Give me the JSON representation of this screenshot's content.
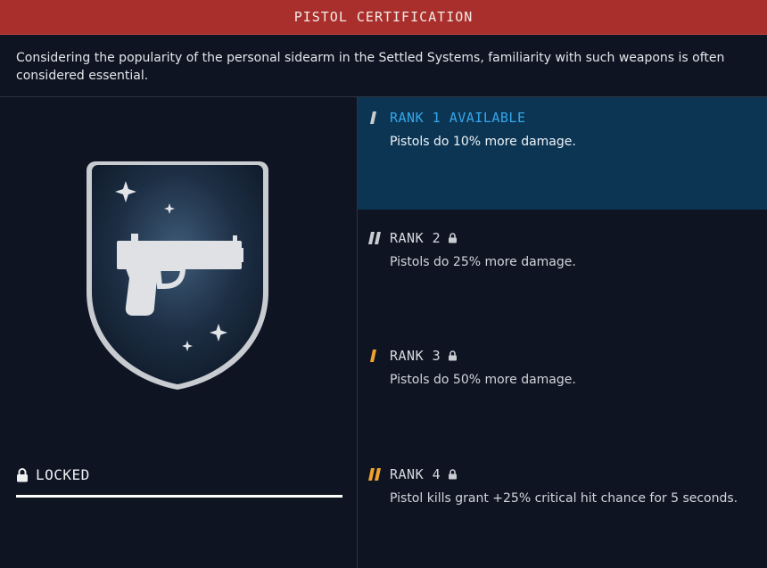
{
  "header": {
    "title": "PISTOL CERTIFICATION"
  },
  "description": "Considering the popularity of the personal sidearm in the Settled Systems, familiarity with such weapons is often considered essential.",
  "status": {
    "label": "LOCKED",
    "progress": 1.0
  },
  "badge": {
    "icon": "pistol-icon",
    "shape": "shield"
  },
  "ranks": [
    {
      "label": "RANK 1 AVAILABLE",
      "text": "Pistols do 10% more damage.",
      "locked": false,
      "active": true,
      "marker_color": "#c9ccd1"
    },
    {
      "label": "RANK 2",
      "text": "Pistols do 25% more damage.",
      "locked": true,
      "active": false,
      "marker_color": "#c9ccd1"
    },
    {
      "label": "RANK 3",
      "text": "Pistols do 50% more damage.",
      "locked": true,
      "active": false,
      "marker_color": "#f0a22c"
    },
    {
      "label": "RANK 4",
      "text": "Pistol kills grant +25% critical hit chance for 5 seconds.",
      "locked": true,
      "active": false,
      "marker_color": "#f0a22c"
    }
  ],
  "colors": {
    "header_red": "#a92f2c",
    "active_blue": "#0c3554",
    "available_text": "#34a7ea",
    "tier_gold": "#f0a22c"
  }
}
